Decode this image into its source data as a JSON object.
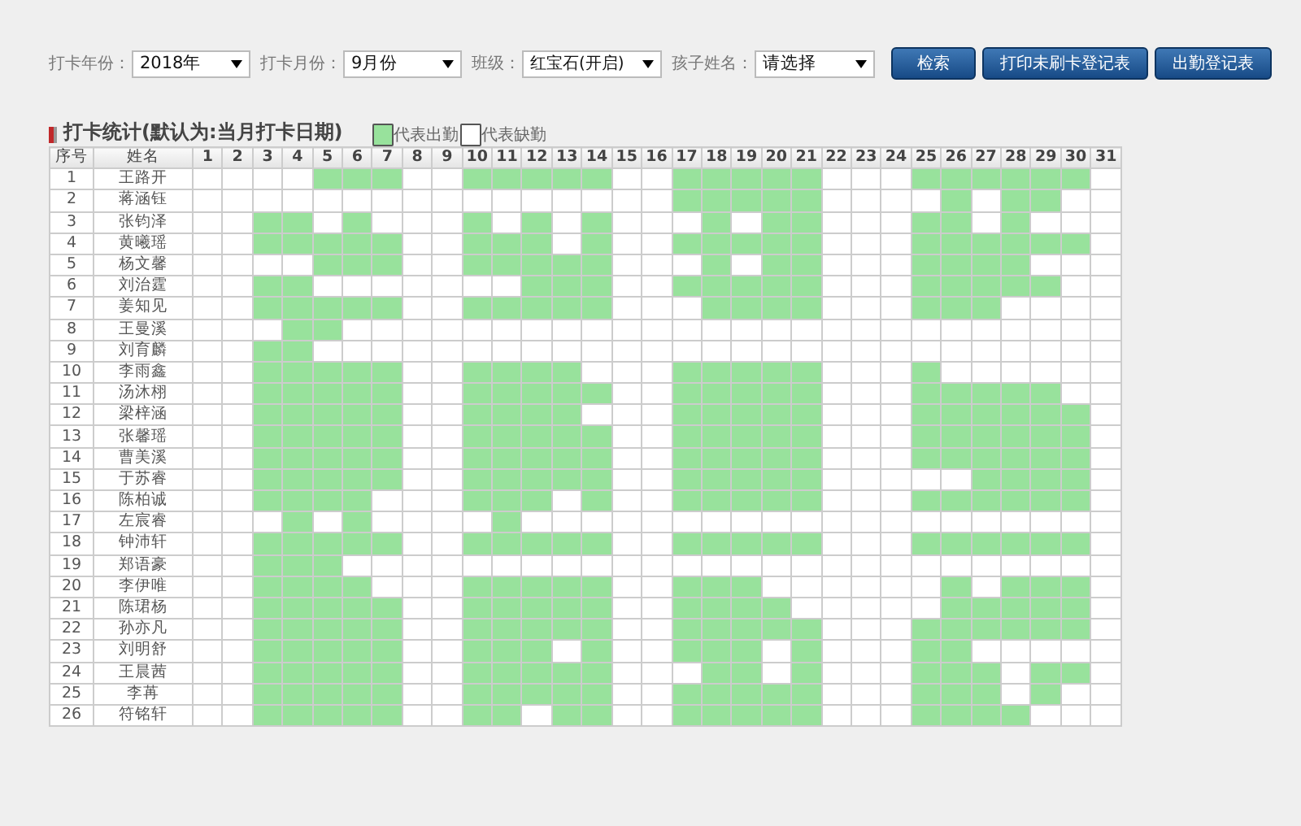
{
  "filters": [
    {
      "label": "打卡年份：",
      "value": "2018年"
    },
    {
      "label": "打卡月份：",
      "value": "9月份"
    },
    {
      "label": "班级：",
      "value": "红宝石(开启)"
    },
    {
      "label": "孩子姓名：",
      "value": "请选择"
    }
  ],
  "buttons": [
    "检索",
    "打印未刷卡登记表",
    "出勤登记表"
  ],
  "section_title": "打卡统计(默认为:当月打卡日期)",
  "legend": [
    {
      "label": "代表出勤",
      "present": true
    },
    {
      "label": "代表缺勤",
      "present": false
    }
  ],
  "table": {
    "columns": [
      "序号",
      "姓名",
      "1",
      "2",
      "3",
      "4",
      "5",
      "6",
      "7",
      "8",
      "9",
      "10",
      "11",
      "12",
      "13",
      "14",
      "15",
      "16",
      "17",
      "18",
      "19",
      "20",
      "21",
      "22",
      "23",
      "24",
      "25",
      "26",
      "27",
      "28",
      "29",
      "30",
      "31"
    ],
    "rows": [
      {
        "no": "1",
        "name": "王路开",
        "present": [
          false,
          false,
          false,
          false,
          true,
          true,
          true,
          false,
          false,
          true,
          true,
          true,
          true,
          true,
          false,
          false,
          true,
          true,
          true,
          true,
          true,
          false,
          false,
          false,
          true,
          true,
          true,
          true,
          true,
          true,
          false
        ]
      },
      {
        "no": "2",
        "name": "蒋涵钰",
        "present": [
          false,
          false,
          false,
          false,
          false,
          false,
          false,
          false,
          false,
          false,
          false,
          false,
          false,
          false,
          false,
          false,
          true,
          true,
          true,
          true,
          true,
          false,
          false,
          false,
          false,
          true,
          false,
          true,
          true,
          false,
          false
        ]
      },
      {
        "no": "3",
        "name": "张钧泽",
        "present": [
          false,
          false,
          true,
          true,
          false,
          true,
          false,
          false,
          false,
          true,
          false,
          true,
          false,
          true,
          false,
          false,
          false,
          true,
          false,
          true,
          true,
          false,
          false,
          false,
          true,
          true,
          false,
          true,
          false,
          false,
          false
        ]
      },
      {
        "no": "4",
        "name": "黄曦瑶",
        "present": [
          false,
          false,
          true,
          true,
          true,
          true,
          true,
          false,
          false,
          true,
          true,
          true,
          false,
          true,
          false,
          false,
          true,
          true,
          true,
          true,
          true,
          false,
          false,
          false,
          true,
          true,
          true,
          true,
          true,
          true,
          false
        ]
      },
      {
        "no": "5",
        "name": "杨文馨",
        "present": [
          false,
          false,
          false,
          false,
          true,
          true,
          true,
          false,
          false,
          true,
          true,
          true,
          true,
          true,
          false,
          false,
          false,
          true,
          false,
          true,
          true,
          false,
          false,
          false,
          true,
          true,
          true,
          true,
          false,
          false,
          false
        ]
      },
      {
        "no": "6",
        "name": "刘治霆",
        "present": [
          false,
          false,
          true,
          true,
          false,
          false,
          false,
          false,
          false,
          false,
          false,
          true,
          true,
          true,
          false,
          false,
          true,
          true,
          true,
          true,
          true,
          false,
          false,
          false,
          true,
          true,
          true,
          true,
          true,
          false,
          false
        ]
      },
      {
        "no": "7",
        "name": "姜知见",
        "present": [
          false,
          false,
          true,
          true,
          true,
          true,
          true,
          false,
          false,
          true,
          true,
          true,
          true,
          true,
          false,
          false,
          false,
          true,
          true,
          true,
          true,
          false,
          false,
          false,
          true,
          true,
          true,
          false,
          false,
          false,
          false
        ]
      },
      {
        "no": "8",
        "name": "王曼溪",
        "present": [
          false,
          false,
          false,
          true,
          true,
          false,
          false,
          false,
          false,
          false,
          false,
          false,
          false,
          false,
          false,
          false,
          false,
          false,
          false,
          false,
          false,
          false,
          false,
          false,
          false,
          false,
          false,
          false,
          false,
          false,
          false
        ]
      },
      {
        "no": "9",
        "name": "刘育麟",
        "present": [
          false,
          false,
          true,
          true,
          false,
          false,
          false,
          false,
          false,
          false,
          false,
          false,
          false,
          false,
          false,
          false,
          false,
          false,
          false,
          false,
          false,
          false,
          false,
          false,
          false,
          false,
          false,
          false,
          false,
          false,
          false
        ]
      },
      {
        "no": "10",
        "name": "李雨鑫",
        "present": [
          false,
          false,
          true,
          true,
          true,
          true,
          true,
          false,
          false,
          true,
          true,
          true,
          true,
          false,
          false,
          false,
          true,
          true,
          true,
          true,
          true,
          false,
          false,
          false,
          true,
          false,
          false,
          false,
          false,
          false,
          false
        ]
      },
      {
        "no": "11",
        "name": "汤沐栩",
        "present": [
          false,
          false,
          true,
          true,
          true,
          true,
          true,
          false,
          false,
          true,
          true,
          true,
          true,
          true,
          false,
          false,
          true,
          true,
          true,
          true,
          true,
          false,
          false,
          false,
          true,
          true,
          true,
          true,
          true,
          false,
          false
        ]
      },
      {
        "no": "12",
        "name": "梁梓涵",
        "present": [
          false,
          false,
          true,
          true,
          true,
          true,
          true,
          false,
          false,
          true,
          true,
          true,
          true,
          false,
          false,
          false,
          true,
          true,
          true,
          true,
          true,
          false,
          false,
          false,
          true,
          true,
          true,
          true,
          true,
          true,
          false
        ]
      },
      {
        "no": "13",
        "name": "张馨瑶",
        "present": [
          false,
          false,
          true,
          true,
          true,
          true,
          true,
          false,
          false,
          true,
          true,
          true,
          true,
          true,
          false,
          false,
          true,
          true,
          true,
          true,
          true,
          false,
          false,
          false,
          true,
          true,
          true,
          true,
          true,
          true,
          false
        ]
      },
      {
        "no": "14",
        "name": "曹美溪",
        "present": [
          false,
          false,
          true,
          true,
          true,
          true,
          true,
          false,
          false,
          true,
          true,
          true,
          true,
          true,
          false,
          false,
          true,
          true,
          true,
          true,
          true,
          false,
          false,
          false,
          true,
          true,
          true,
          true,
          true,
          true,
          false
        ]
      },
      {
        "no": "15",
        "name": "于苏睿",
        "present": [
          false,
          false,
          true,
          true,
          true,
          true,
          true,
          false,
          false,
          true,
          true,
          true,
          true,
          true,
          false,
          false,
          true,
          true,
          true,
          true,
          true,
          false,
          false,
          false,
          false,
          false,
          true,
          true,
          true,
          true,
          false
        ]
      },
      {
        "no": "16",
        "name": "陈柏诚",
        "present": [
          false,
          false,
          true,
          true,
          true,
          true,
          false,
          false,
          false,
          true,
          true,
          true,
          false,
          true,
          false,
          false,
          true,
          true,
          true,
          true,
          true,
          false,
          false,
          false,
          true,
          true,
          true,
          true,
          true,
          true,
          false
        ]
      },
      {
        "no": "17",
        "name": "左宸睿",
        "present": [
          false,
          false,
          false,
          true,
          false,
          true,
          false,
          false,
          false,
          false,
          true,
          false,
          false,
          false,
          false,
          false,
          false,
          false,
          false,
          false,
          false,
          false,
          false,
          false,
          false,
          false,
          false,
          false,
          false,
          false,
          false
        ]
      },
      {
        "no": "18",
        "name": "钟沛轩",
        "present": [
          false,
          false,
          true,
          true,
          true,
          true,
          true,
          false,
          false,
          true,
          true,
          true,
          true,
          true,
          false,
          false,
          true,
          true,
          true,
          true,
          true,
          false,
          false,
          false,
          true,
          true,
          true,
          true,
          true,
          true,
          false
        ]
      },
      {
        "no": "19",
        "name": "郑语豪",
        "present": [
          false,
          false,
          true,
          true,
          true,
          false,
          false,
          false,
          false,
          false,
          false,
          false,
          false,
          false,
          false,
          false,
          false,
          false,
          false,
          false,
          false,
          false,
          false,
          false,
          false,
          false,
          false,
          false,
          false,
          false,
          false
        ]
      },
      {
        "no": "20",
        "name": "李伊唯",
        "present": [
          false,
          false,
          true,
          true,
          true,
          true,
          false,
          false,
          false,
          true,
          true,
          true,
          true,
          true,
          false,
          false,
          true,
          true,
          true,
          false,
          false,
          false,
          false,
          false,
          false,
          true,
          false,
          true,
          true,
          true,
          false
        ]
      },
      {
        "no": "21",
        "name": "陈珺杨",
        "present": [
          false,
          false,
          true,
          true,
          true,
          true,
          true,
          false,
          false,
          true,
          true,
          true,
          true,
          true,
          false,
          false,
          true,
          true,
          true,
          true,
          false,
          false,
          false,
          false,
          false,
          true,
          true,
          true,
          true,
          true,
          false
        ]
      },
      {
        "no": "22",
        "name": "孙亦凡",
        "present": [
          false,
          false,
          true,
          true,
          true,
          true,
          true,
          false,
          false,
          true,
          true,
          true,
          true,
          true,
          false,
          false,
          true,
          true,
          true,
          true,
          true,
          false,
          false,
          false,
          true,
          true,
          true,
          true,
          true,
          true,
          false
        ]
      },
      {
        "no": "23",
        "name": "刘明舒",
        "present": [
          false,
          false,
          true,
          true,
          true,
          true,
          true,
          false,
          false,
          true,
          true,
          true,
          false,
          true,
          false,
          false,
          true,
          true,
          true,
          false,
          true,
          false,
          false,
          false,
          true,
          true,
          false,
          false,
          false,
          false,
          false
        ]
      },
      {
        "no": "24",
        "name": "王晨茜",
        "present": [
          false,
          false,
          true,
          true,
          true,
          true,
          true,
          false,
          false,
          true,
          true,
          true,
          true,
          true,
          false,
          false,
          false,
          true,
          true,
          false,
          true,
          false,
          false,
          false,
          true,
          true,
          true,
          false,
          true,
          true,
          false
        ]
      },
      {
        "no": "25",
        "name": "李苒",
        "present": [
          false,
          false,
          true,
          true,
          true,
          true,
          true,
          false,
          false,
          true,
          true,
          true,
          true,
          true,
          false,
          false,
          true,
          true,
          true,
          true,
          true,
          false,
          false,
          false,
          true,
          true,
          true,
          false,
          true,
          false,
          false
        ]
      },
      {
        "no": "26",
        "name": "符铭轩",
        "present": [
          false,
          false,
          true,
          true,
          true,
          true,
          true,
          false,
          false,
          true,
          true,
          false,
          true,
          true,
          false,
          false,
          true,
          true,
          true,
          true,
          true,
          false,
          false,
          false,
          true,
          true,
          true,
          true,
          false,
          false,
          false
        ]
      }
    ]
  }
}
